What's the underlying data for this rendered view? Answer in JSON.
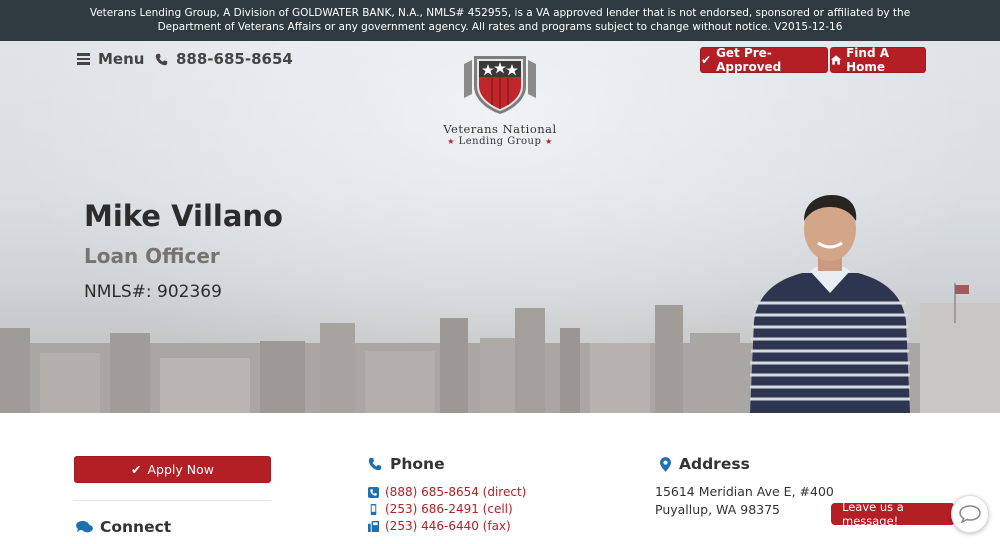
{
  "disclaimer": "Veterans Lending Group, A Division of GOLDWATER BANK, N.A., NMLS# 452955, is a VA approved lender that is not endorsed, sponsored or affiliated by the Department of Veterans Affairs or any government agency.  All rates and programs subject to change without notice. V2015-12-16",
  "nav": {
    "menu_label": "Menu",
    "menu_icon": "hamburger-icon",
    "phone": "888-685-8654",
    "phone_icon": "phone-icon",
    "pre_approved_label": "Get Pre-Approved",
    "pre_approved_icon": "checkmark-icon",
    "find_home_label": "Find A Home",
    "find_home_icon": "home-icon"
  },
  "logo": {
    "line1": "Veterans National",
    "line2": "Lending Group"
  },
  "profile": {
    "name": "Mike Villano",
    "title": "Loan Officer",
    "nmls": "NMLS#: 902369"
  },
  "sidebar": {
    "apply_label": "Apply Now",
    "connect_label": "Connect"
  },
  "phone_section": {
    "heading": "Phone",
    "numbers": [
      {
        "label": "(888) 685-8654 (direct)",
        "icon": "phone-square-icon"
      },
      {
        "label": "(253) 686-2491 (cell)",
        "icon": "mobile-icon"
      },
      {
        "label": "(253) 446-6440 (fax)",
        "icon": "fax-icon"
      }
    ]
  },
  "address_section": {
    "heading": "Address",
    "line1": "15614 Meridian Ave E, #400",
    "line2": "Puyallup, WA 98375"
  },
  "chat": {
    "label": "Leave us a message!"
  },
  "colors": {
    "brand_red": "#b31f24",
    "disclaimer_bg": "#2e3a3f",
    "accent_blue": "#1f6fb2"
  }
}
